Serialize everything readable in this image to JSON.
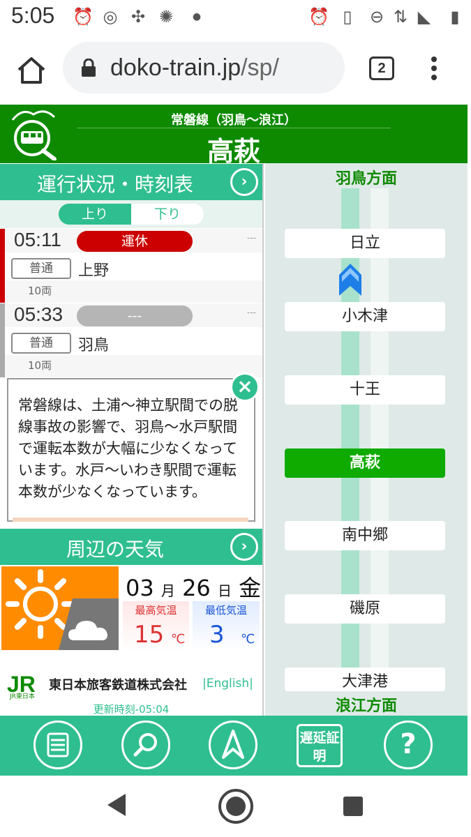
{
  "status_bar": {
    "time": "5:05"
  },
  "browser": {
    "url_host": "doko-train.jp",
    "url_path": "/sp/",
    "tab_count": "2"
  },
  "header": {
    "route": "常磐線（羽鳥〜浪江）",
    "station": "高萩"
  },
  "schedule": {
    "title": "運行状況・時刻表",
    "tab_up": "上り",
    "tab_down": "下り",
    "trains": [
      {
        "time": "05:11",
        "status": "運休",
        "status_color": "#cc0000",
        "bar_color": "#cc0000",
        "dash": "---",
        "kind": "普通",
        "dest": "上野",
        "cars": "10両"
      },
      {
        "time": "05:33",
        "status": "---",
        "status_color": "#b5b5b5",
        "bar_color": "#aaaaaa",
        "dash": "---",
        "kind": "普通",
        "dest": "羽鳥",
        "cars": "10両"
      }
    ]
  },
  "notice": {
    "text": "常磐線は、土浦〜神立駅間での脱線事故の影響で、羽鳥〜水戸駅間で運転本数が大幅に少なくなっています。水戸〜いわき駅間で運転本数が少なくなっています。",
    "close": "×"
  },
  "weather": {
    "title": "周辺の天気",
    "month": "03",
    "month_unit": "月",
    "day": "26",
    "day_unit": "日",
    "weekday": "金",
    "high_label": "最高気温",
    "high": "15",
    "low_label": "最低気温",
    "low": "3",
    "unit": "℃",
    "icons": [
      "sun-icon",
      "cloud-icon"
    ]
  },
  "footer": {
    "jr_logo": "JR",
    "jr_sub": "JR東日本",
    "company": "東日本旅客鉄道株式会社",
    "english": "|English|",
    "updated": "更新時刻-05:04"
  },
  "map": {
    "top_direction": "羽鳥方面",
    "bottom_direction": "浪江方面",
    "stations": [
      "日立",
      "小木津",
      "十王",
      "高萩",
      "南中郷",
      "磯原",
      "大津港"
    ],
    "current": "高萩"
  },
  "toolbar": {
    "cert_label": "遅延証明",
    "help": "?",
    "icons": [
      "list-icon",
      "search-icon",
      "navigate-icon",
      "delay-certificate-icon",
      "help-icon"
    ]
  },
  "colors": {
    "header_green": "#0e8a00",
    "accent_teal": "#2fbe8f",
    "current_station": "#0fab00",
    "cancel_red": "#cc0000"
  }
}
